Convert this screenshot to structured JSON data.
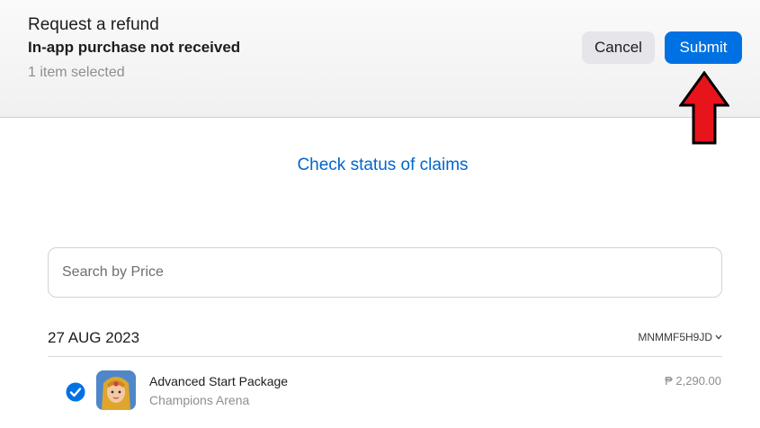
{
  "header": {
    "title": "Request a refund",
    "subtitle": "In-app purchase not received",
    "selected_count": "1 item selected",
    "cancel_label": "Cancel",
    "submit_label": "Submit"
  },
  "links": {
    "check_status": "Check status of claims"
  },
  "search": {
    "placeholder": "Search by Price",
    "value": ""
  },
  "purchase_group": {
    "date": "27 AUG 2023",
    "order_id": "MNMMF5H9JD",
    "order_chevron_icon": "chevron-down-icon",
    "items": [
      {
        "name": "Advanced Start Package",
        "app": "Champions Arena",
        "price": "₱ 2,290.00",
        "selected": true
      }
    ]
  },
  "colors": {
    "accent": "#0071e3",
    "link": "#0066cc",
    "arrow": "#e8141b"
  }
}
